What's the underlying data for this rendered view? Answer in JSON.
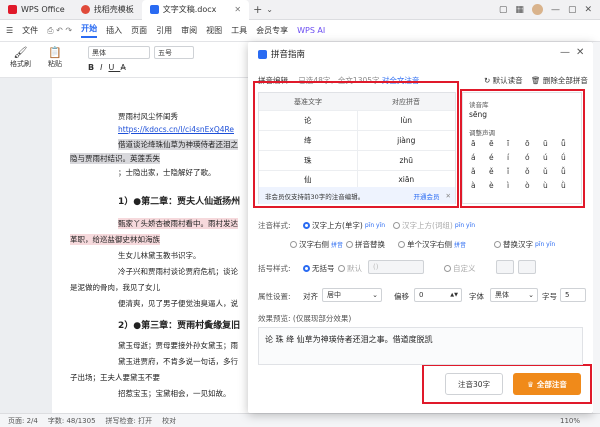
{
  "tabs": {
    "home": "WPS Office",
    "template": "找稻壳模板",
    "doc": "文字文稿.docx"
  },
  "menu": [
    "文件",
    "开始",
    "插入",
    "页面",
    "引用",
    "审阅",
    "视图",
    "工具",
    "会员专享",
    "WPS AI"
  ],
  "toolbar": {
    "format_painter": "格式刷",
    "paste": "粘贴",
    "font": "黑体",
    "size": "五号"
  },
  "doc": [
    "贾雨村风尘怀闺秀",
    "https://kdocs.cn/l/ci4snExQ4Re",
    "借道谈论绛珠仙草为神瑛侍者还泪之",
    "隐与贾雨村结识。英莲丢失",
    "；士隐出家，士隐解好了歌。",
    "1）●第二章：贾夫人仙逝扬州",
    "甄家丫头娇杏被雨村看中。雨村发达",
    "革职，给巡盐御史林如海族",
    "生女儿林黛玉教书识字。",
    "冷子兴和贾雨村谈论贾府危机；谈论",
    "是泥做的骨肉，我见了女儿",
    "便清爽，见了男子便觉浊臭逼人，说",
    "2）●第三章：贾雨村夤缘复旧",
    "黛玉母逝；贾母要接外孙女黛玉；雨",
    "黛玉进贾府，不肯多说一句话，多行",
    "子出场；王夫人要黛玉不要",
    "招惹宝玉；宝黛相会，一见如故。"
  ],
  "status": {
    "page": "页面: 2/4",
    "words": "字数: 48/1305",
    "spell": "拼写检查: 打开",
    "proof": "校对",
    "zoom": "110%"
  },
  "dialog": {
    "title": "拼音指南",
    "tab": "拼音编辑",
    "info": "已选48字，全文1305字",
    "info_link": "对全文注音",
    "default_pinyin": "默认读音",
    "delete_all": "删除全部拼音",
    "table": {
      "col_char": "基准文字",
      "col_py": "对应拼音",
      "rows": [
        {
          "c": "论",
          "p": "lùn"
        },
        {
          "c": "绛",
          "p": "jiàng"
        },
        {
          "c": "珠",
          "p": "zhū"
        },
        {
          "c": "仙",
          "p": "xiān"
        }
      ],
      "foot": "非会员仅支持前30字的注音编辑。",
      "vip": "开通会员"
    },
    "pinyin_lib": "读音库",
    "pinyin_value": "sēng",
    "tone_label": "调整声调",
    "tones": [
      [
        "ā",
        "á",
        "ǎ",
        "à"
      ],
      [
        "ē",
        "é",
        "ě",
        "è"
      ],
      [
        "ī",
        "í",
        "ǐ",
        "ì"
      ],
      [
        "ō",
        "ó",
        "ǒ",
        "ò"
      ],
      [
        "ū",
        "ú",
        "ǔ",
        "ù"
      ],
      [
        "ǖ",
        "ǘ",
        "ǚ",
        "ǜ"
      ]
    ],
    "style_label": "注音样式:",
    "style_opts": [
      "汉字上方(单字)",
      "汉字上方(词组)",
      "汉字右侧",
      "拼音替换",
      "单个汉字右侧",
      "替换汉字"
    ],
    "sample_py": "pīn yīn",
    "sample_hz": "拼音",
    "bracket_label": "括号样式:",
    "bracket_opts": [
      "无括号",
      "默认",
      "自定义"
    ],
    "bracket_default": "()",
    "prop_label": "属性设置:",
    "align_label": "对齐",
    "align_value": "居中",
    "offset_label": "偏移",
    "offset_value": "0",
    "font_label": "字体",
    "font_value": "黑体",
    "size_label": "字号",
    "size_value": "5",
    "preview_label": "效果预览: (仅展现部分效果)",
    "preview_text": "论 珠 绛 仙草为神瑛侍者还泪之事。借道度脱凯",
    "btn_30": "注音30字",
    "btn_all": "全部注音"
  },
  "colors": {
    "accent": "#2a6bf2",
    "orange": "#f08a1a",
    "highlight": "#e0192a"
  }
}
